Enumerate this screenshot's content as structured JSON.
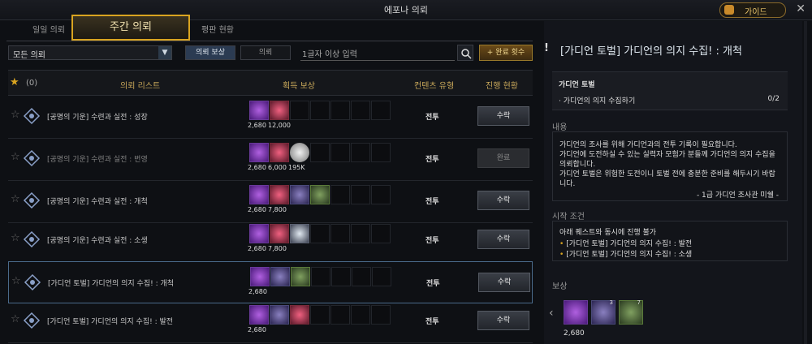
{
  "window": {
    "title": "에포나 의뢰",
    "guide_label": "가이드",
    "close": "✕"
  },
  "tabs": {
    "daily": "일일 의뢰",
    "weekly": "주간 의뢰",
    "reputation": "평판 현황"
  },
  "filter": {
    "selected": "모든 의뢰",
    "seg_reward": "의뢰 보상",
    "seg_quest": "의뢰",
    "search_placeholder": "1글자 이상 입력",
    "complete_count": "+ 완료 횟수"
  },
  "header": {
    "fav_count": "(0)",
    "list": "의뢰 리스트",
    "reward": "획득 보상",
    "type": "컨텐츠 유형",
    "progress": "진행 현황"
  },
  "rows": [
    {
      "name": "[공명의 기운] 수련과 실전 : 성장",
      "type": "전투",
      "btn": "수락",
      "rewards": [
        {
          "kind": "purple",
          "qty": "2,680"
        },
        {
          "kind": "red",
          "qty": "12,000"
        }
      ]
    },
    {
      "name": "[공명의 기운] 수련과 실전 : 번영",
      "type": "전투",
      "btn": "완료",
      "rewards": [
        {
          "kind": "purple",
          "qty": "2,680"
        },
        {
          "kind": "red",
          "qty": "6,000"
        },
        {
          "kind": "coin",
          "qty": "195K"
        }
      ]
    },
    {
      "name": "[공명의 기운] 수련과 실전 : 개척",
      "type": "전투",
      "btn": "수락",
      "rewards": [
        {
          "kind": "purple",
          "qty": "2,680"
        },
        {
          "kind": "red",
          "qty": "7,800"
        },
        {
          "kind": "ore",
          "qty": ""
        },
        {
          "kind": "chest",
          "qty": ""
        }
      ]
    },
    {
      "name": "[공명의 기운] 수련과 실전 : 소생",
      "type": "전투",
      "btn": "수락",
      "rewards": [
        {
          "kind": "purple",
          "qty": "2,680"
        },
        {
          "kind": "red",
          "qty": "7,800"
        },
        {
          "kind": "blade",
          "qty": ""
        }
      ]
    },
    {
      "name": "[가디언 토벌] 가디언의 의지 수집! : 개척",
      "type": "전투",
      "btn": "수락",
      "rewards": [
        {
          "kind": "purple",
          "qty": "2,680"
        },
        {
          "kind": "ore",
          "qty": ""
        },
        {
          "kind": "chest",
          "qty": ""
        }
      ]
    },
    {
      "name": "[가디언 토벌] 가디언의 의지 수집! : 발전",
      "type": "전투",
      "btn": "수락",
      "rewards": [
        {
          "kind": "purple",
          "qty": "2,680"
        },
        {
          "kind": "ore",
          "qty": ""
        },
        {
          "kind": "red",
          "qty": ""
        }
      ]
    }
  ],
  "detail": {
    "title": "[가디언 토벌] 가디언의 의지 수집! : 개척",
    "objective_header": "가디언 토벌",
    "objective_item": "· 가디언의 의지 수집하기",
    "objective_progress": "0/2",
    "content_label": "내용",
    "content_lines": [
      "가디언의 조사를 위해 가디언과의 전투 기록이 필요합니다.",
      "가디언에 도전하실 수 있는 실력자 모험가 분들께 가디언의 의지 수집을",
      "의뢰합니다.",
      "가디언 토벌은 위험한 도전이니 토벌 전에 충분한 준비를 해두시기 바랍",
      "니다."
    ],
    "signature": "- 1급 가디언 조사관 미쉘 -",
    "start_label": "시작 조건",
    "start_header": "아래 퀘스트와 동시에 진행 불가",
    "start_items": [
      "[가디언 토벌] 가디언의 의지 수집! : 발전",
      "[가디언 토벌] 가디언의 의지 수집! : 소생"
    ],
    "reward_label": "보상",
    "reward_qty": "2,680",
    "reward_ore_qty": "3",
    "reward_chest_qty": "7"
  }
}
